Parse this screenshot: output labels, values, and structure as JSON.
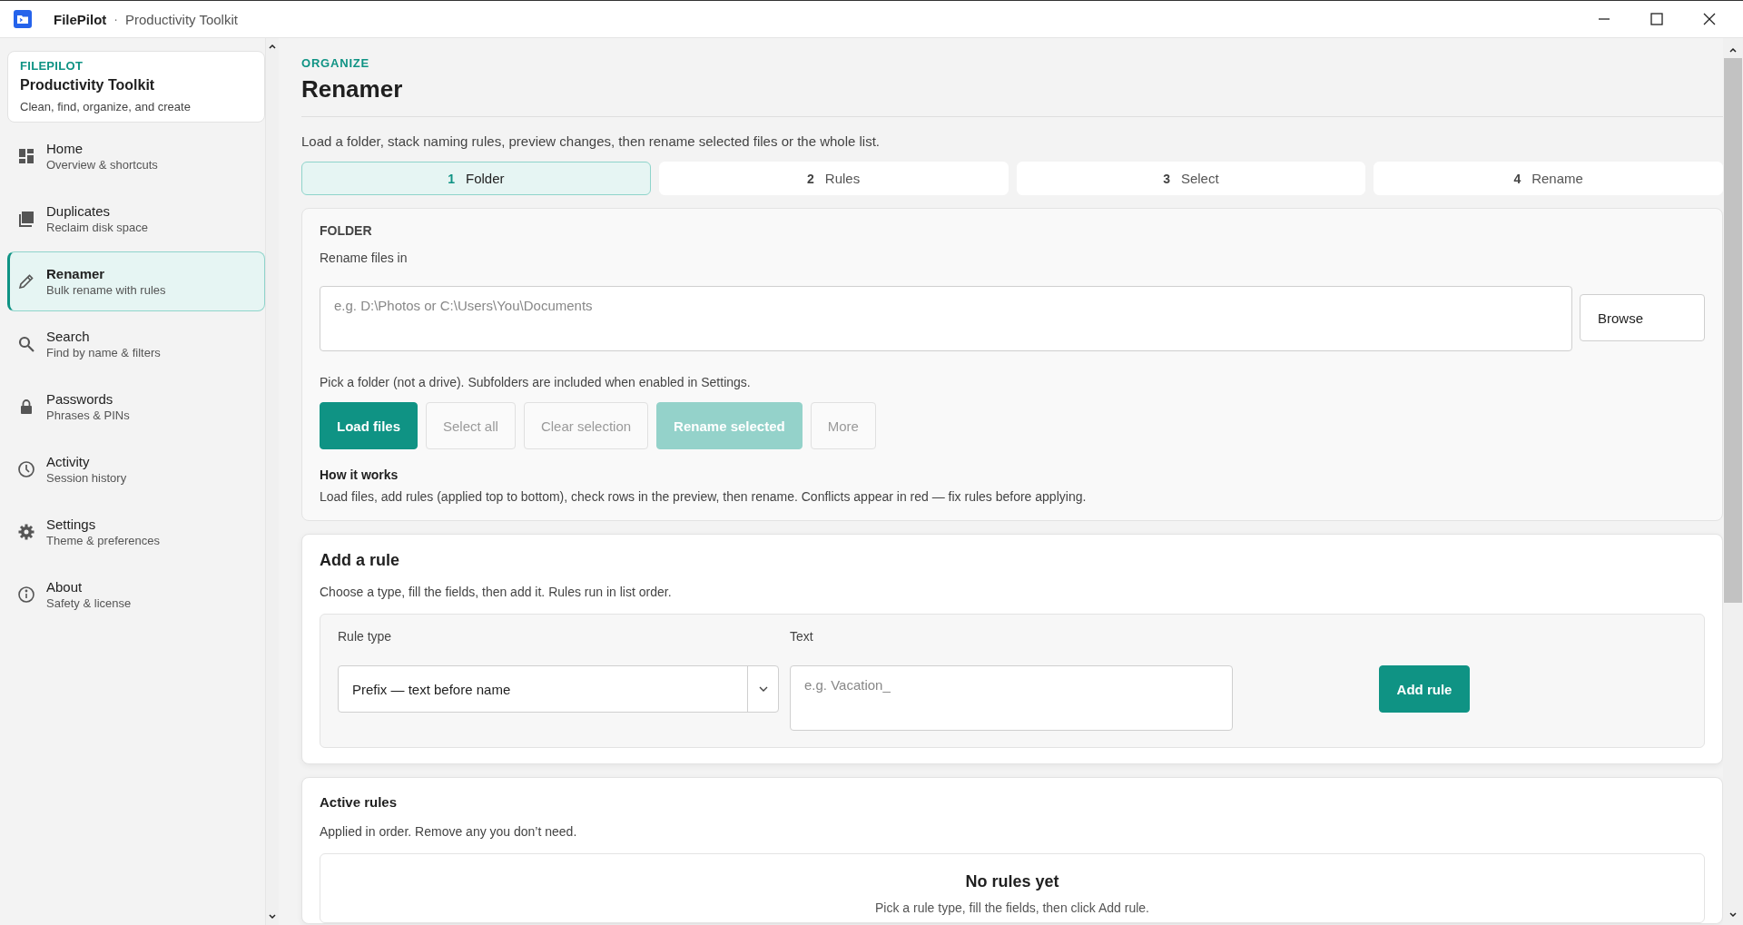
{
  "window": {
    "app_name": "FilePilot",
    "subtitle": "Productivity Toolkit",
    "separator": "·"
  },
  "sidebar": {
    "brand": {
      "eyebrow": "FILEPILOT",
      "title": "Productivity Toolkit",
      "tagline": "Clean, find, organize, and create"
    },
    "items": [
      {
        "label": "Home",
        "description": "Overview & shortcuts",
        "selected": false
      },
      {
        "label": "Duplicates",
        "description": "Reclaim disk space",
        "selected": false
      },
      {
        "label": "Renamer",
        "description": "Bulk rename with rules",
        "selected": true
      },
      {
        "label": "Search",
        "description": "Find by name & filters",
        "selected": false
      },
      {
        "label": "Passwords",
        "description": "Phrases & PINs",
        "selected": false
      },
      {
        "label": "Activity",
        "description": "Session history",
        "selected": false
      },
      {
        "label": "Settings",
        "description": "Theme & preferences",
        "selected": false
      },
      {
        "label": "About",
        "description": "Safety & license",
        "selected": false
      }
    ]
  },
  "page": {
    "eyebrow": "ORGANIZE",
    "title": "Renamer",
    "description": "Load a folder, stack naming rules, preview changes, then rename selected files or the whole list.",
    "steps": [
      {
        "number": "1",
        "label": "Folder",
        "selected": true
      },
      {
        "number": "2",
        "label": "Rules",
        "selected": false
      },
      {
        "number": "3",
        "label": "Select",
        "selected": false
      },
      {
        "number": "4",
        "label": "Rename",
        "selected": false
      }
    ],
    "folder": {
      "heading": "FOLDER",
      "field_label": "Rename files in",
      "placeholder": "e.g. D:\\Photos or C:\\Users\\You\\Documents",
      "browse": "Browse",
      "hint": "Pick a folder (not a drive). Subfolders are included when enabled in Settings.",
      "buttons": [
        {
          "label": "Load files",
          "kind": "primary",
          "disabled": false
        },
        {
          "label": "Select all",
          "kind": "secondary",
          "disabled": true
        },
        {
          "label": "Clear selection",
          "kind": "secondary",
          "disabled": true
        },
        {
          "label": "Rename selected",
          "kind": "primary",
          "disabled": true
        },
        {
          "label": "More",
          "kind": "secondary",
          "disabled": true
        }
      ],
      "how_title": "How it works",
      "how_text": "Load files, add rules (applied top to bottom), check rows in the preview, then rename. Conflicts appear in red — fix rules before applying."
    },
    "add_rule": {
      "title": "Add a rule",
      "description": "Choose a type, fill the fields, then add it. Rules run in list order.",
      "type_label": "Rule type",
      "type_value": "Prefix — text before name",
      "text_label": "Text",
      "text_placeholder": "e.g. Vacation_",
      "button": "Add rule"
    },
    "active_rules": {
      "title": "Active rules",
      "description": "Applied in order. Remove any you don’t need.",
      "empty_title": "No rules yet",
      "empty_text": "Pick a rule type, fill the fields, then click Add rule."
    }
  }
}
